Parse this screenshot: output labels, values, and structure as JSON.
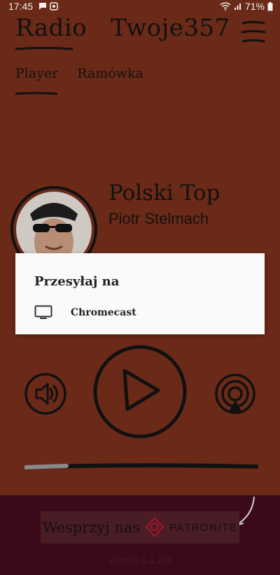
{
  "status_bar": {
    "time": "17:45",
    "battery": "71%"
  },
  "app": {
    "title": "Radio   Twoje357"
  },
  "tabs": [
    {
      "label": "Player"
    },
    {
      "label": "Ramówka"
    }
  ],
  "now_playing": {
    "show": "Polski Top",
    "host": "Piotr Stelmach"
  },
  "cast_dialog": {
    "title": "Przesyłaj na",
    "option": "Chromecast"
  },
  "footer": {
    "support_label": "Wesprzyj nas",
    "patronite_label": "PATRONITE",
    "version": "Wersja 1.1.2.3"
  },
  "icons": [
    "chat-icon",
    "image-icon",
    "wifi-icon",
    "signal-icon",
    "battery-icon",
    "menu-icon",
    "cast-tv-icon",
    "volume-icon",
    "play-icon",
    "airplay-icon",
    "patronite-logo-icon",
    "arrow-icon"
  ],
  "colors": {
    "background": "#6b2a17",
    "footer": "#3a0a1a",
    "dialog": "#fafafa",
    "ink": "#111111"
  }
}
